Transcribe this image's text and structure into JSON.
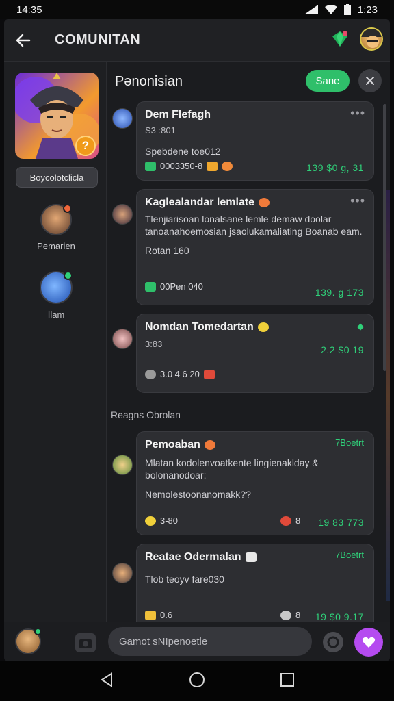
{
  "status": {
    "time": "14:35",
    "time_right": "1:23"
  },
  "header": {
    "title": "COMUNITAN"
  },
  "sidebar": {
    "hero_tag": "Boycolotclicla",
    "users": [
      {
        "name": "Pemarien"
      },
      {
        "name": "Ilam"
      }
    ]
  },
  "main": {
    "title": "Pənonisian",
    "save_label": "Sane"
  },
  "posts": [
    {
      "title": "Dem Flefagh",
      "meta": "S3 :801",
      "text": "Spebdene toe012",
      "reactions": "0003350-8",
      "stat": "139 $0 g, 31"
    },
    {
      "title": "Kaglealandar lemlate",
      "text": "Tlenjiarisoan lonalsane lemle demaw doolar tanoanahoemosian jsaolukamaliating Boanab eam.",
      "sub": "Rotan 160",
      "reactions": "00Pen 040",
      "stat": "139. g 173"
    },
    {
      "title": "Nomdan Tomedartan",
      "meta": "3:83",
      "reactions": "3.0 4 6 20",
      "stat": "2.2 $0 19"
    }
  ],
  "section": {
    "label": "Reagns Obrolan"
  },
  "posts2": [
    {
      "title": "Pemoaban",
      "tag": "7Boetrt",
      "text": "Mlatan kodolenvoatkente lingienaklday & bolonanodoar:",
      "sub": "Nemolestoonanomakk??",
      "left_count": "3-80",
      "right_count": "8",
      "stat": "19 83 773"
    },
    {
      "title": "Reatae Odermalan",
      "tag": "7Boetrt",
      "text": "Tlob teoyv fare030",
      "left_count": "0.6",
      "right_count": "8",
      "stat": "19 $0 9.17"
    }
  ],
  "composer": {
    "placeholder": "Gamot sNIpenoetle"
  }
}
